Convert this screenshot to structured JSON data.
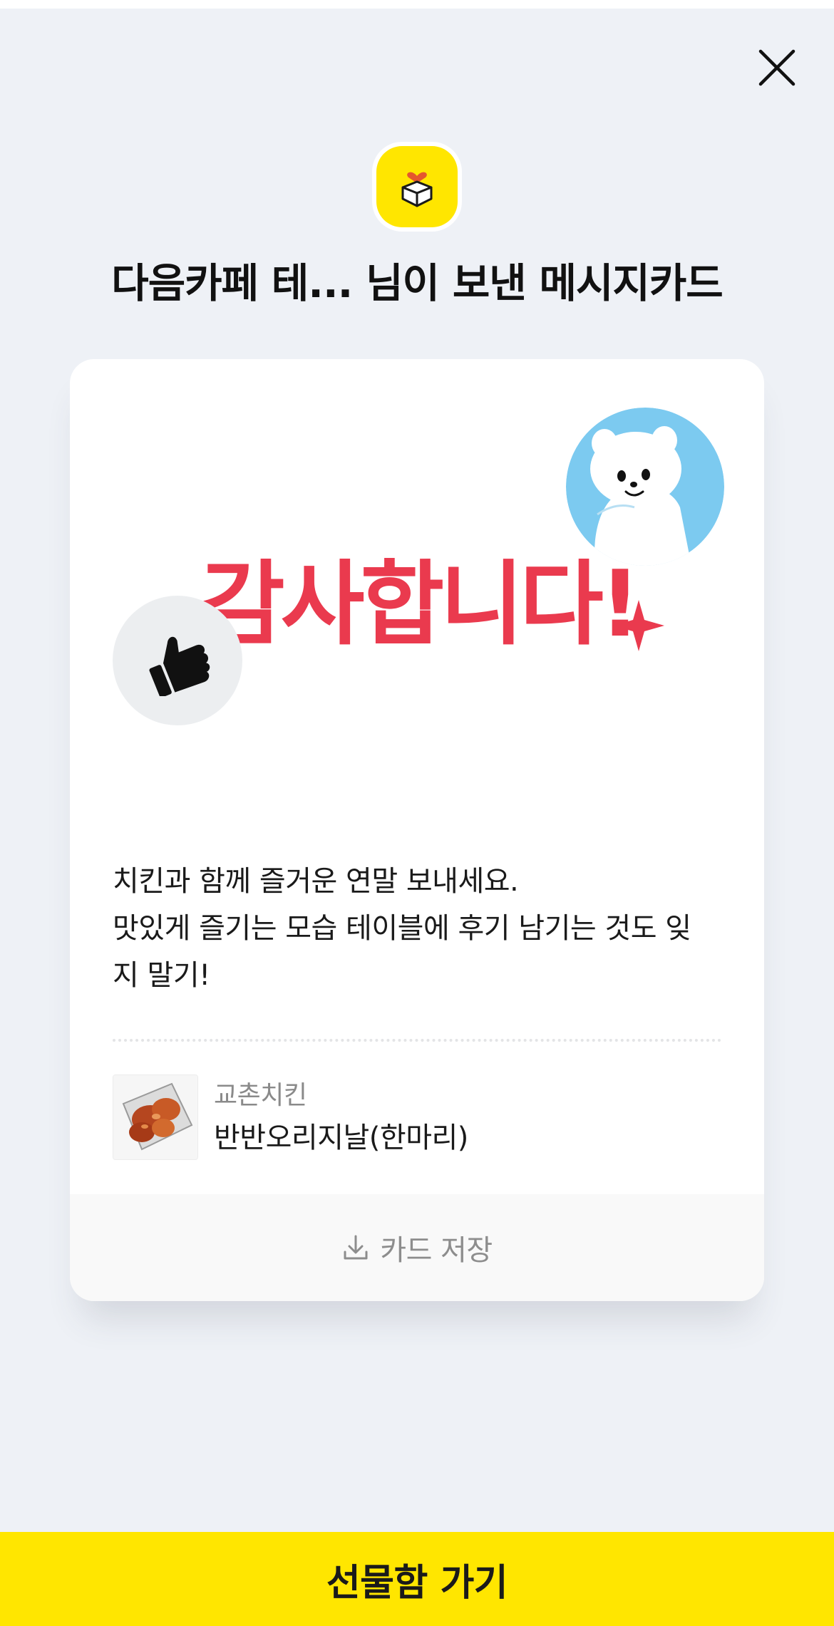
{
  "header": {
    "title": "다음카페 테... 님이 보낸 메시지카드"
  },
  "card": {
    "art_text": "감사합니다!",
    "message_lines": [
      "치킨과 함께 즐거운 연말 보내세요.",
      "맛있게 즐기는 모습 테이블에 후기 남기는 것도 잊",
      "지 말기!"
    ],
    "product": {
      "brand": "교촌치킨",
      "name": "반반오리지날(한마리)"
    },
    "save_label": "카드 저장"
  },
  "footer": {
    "cta_label": "선물함 가기"
  },
  "colors": {
    "background": "#eef1f6",
    "accent_yellow": "#ffe600",
    "art_red": "#ea3a4e",
    "bear_blue": "#7ccaf0"
  },
  "icons": {
    "close": "close-icon",
    "gift": "gift-box-heart-icon",
    "download": "download-icon",
    "thumbs_up": "thumbs-up-icon",
    "bear": "bear-character"
  }
}
